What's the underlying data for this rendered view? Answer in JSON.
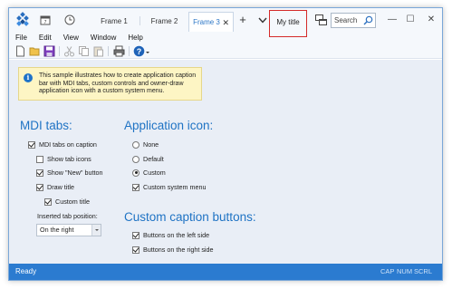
{
  "tabs": [
    {
      "label": "Frame 1",
      "active": false
    },
    {
      "label": "Frame 2",
      "active": false
    },
    {
      "label": "Frame 3",
      "active": true,
      "close": "✕"
    }
  ],
  "new_tab_label": "+",
  "caption_title": "My title",
  "search": {
    "placeholder": "Search"
  },
  "window_controls": {
    "minimize": "—",
    "maximize": "☐",
    "close": "✕"
  },
  "menu": [
    "File",
    "Edit",
    "View",
    "Window",
    "Help"
  ],
  "info_text": "This sample illustrates how to create application caption bar with MDI tabs, custom controls and owner-draw application icon with a custom system menu.",
  "mdi_tabs": {
    "title": "MDI tabs:",
    "options": [
      {
        "label": "MDI tabs on caption",
        "checked": true
      },
      {
        "label": "Show tab icons",
        "checked": false
      },
      {
        "label": "Show \"New\" button",
        "checked": true
      },
      {
        "label": "Draw title",
        "checked": true
      },
      {
        "label": "Custom title",
        "checked": true
      }
    ],
    "position_label": "Inserted tab position:",
    "position_value": "On the right"
  },
  "app_icon": {
    "title": "Application icon:",
    "options": [
      {
        "label": "None",
        "selected": false
      },
      {
        "label": "Default",
        "selected": false
      },
      {
        "label": "Custom",
        "selected": true
      }
    ],
    "system_menu": {
      "label": "Custom system menu",
      "checked": true
    }
  },
  "caption_buttons": {
    "title": "Custom caption buttons:",
    "options": [
      {
        "label": "Buttons on the left side",
        "checked": true
      },
      {
        "label": "Buttons on the right side",
        "checked": true
      }
    ]
  },
  "status": {
    "ready": "Ready",
    "indicators": [
      "CAP",
      "NUM",
      "SCRL"
    ]
  },
  "colors": {
    "accent": "#1f73c4",
    "statusbar": "#2b7bd0",
    "content_bg": "#e9eef6",
    "highlight": "#d42a2a"
  }
}
